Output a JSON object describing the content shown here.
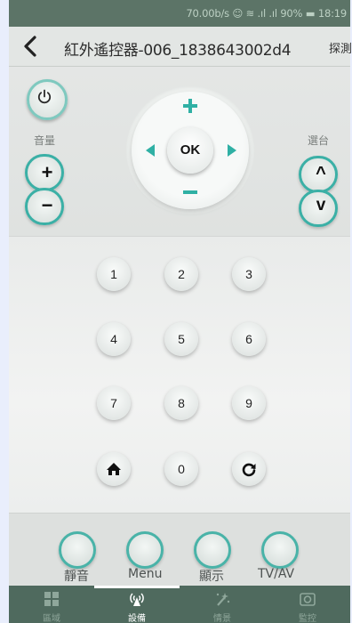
{
  "status_bar": {
    "text": "70.00b/s ☺ ≋ .ıl .ıl 90% ▬ 18:19"
  },
  "header": {
    "title": "紅外遙控器-006_1838643002d4",
    "action_label": "探測"
  },
  "remote": {
    "volume_label": "音量",
    "channel_label": "選台",
    "volume_up_symbol": "+",
    "volume_down_symbol": "−",
    "channel_up_symbol": "^",
    "channel_down_symbol": "v",
    "ok_label": "OK",
    "keys": [
      "1",
      "2",
      "3",
      "4",
      "5",
      "6",
      "7",
      "8",
      "9",
      "0"
    ]
  },
  "function_buttons": {
    "mute_label": "靜音",
    "menu_label": "Menu",
    "display_label": "顯示",
    "tvav_label": "TV/AV"
  },
  "bottom_nav": {
    "items": [
      {
        "label": "區域",
        "icon": "grid-icon"
      },
      {
        "label": "設備",
        "icon": "antenna-icon"
      },
      {
        "label": "情景",
        "icon": "magic-wand-icon"
      },
      {
        "label": "監控",
        "icon": "camera-icon"
      }
    ],
    "active_index": 1
  },
  "colors": {
    "accent": "#2fb0a4",
    "status_bar": "#5c7467",
    "nav_bar": "#4f6a5e"
  }
}
